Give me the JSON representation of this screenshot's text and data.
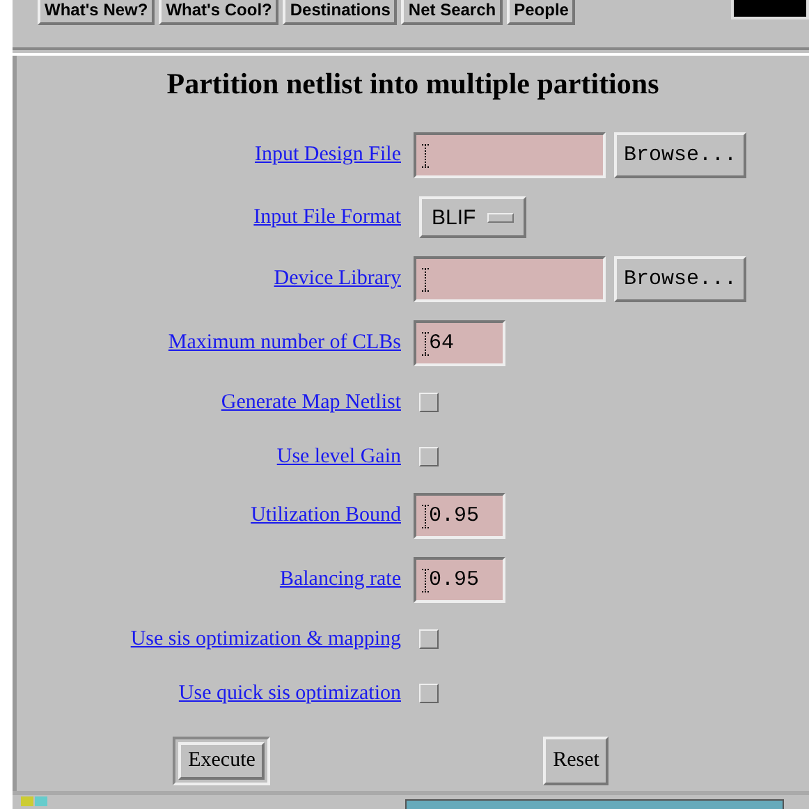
{
  "toolbar": [
    "What's New?",
    "What's Cool?",
    "Destinations",
    "Net Search",
    "People"
  ],
  "title": "Partition netlist into multiple partitions",
  "rows": [
    {
      "kind": "file",
      "label": "Input Design File",
      "value": "",
      "button": "Browse..."
    },
    {
      "kind": "select",
      "label": "Input File Format",
      "value": "BLIF"
    },
    {
      "kind": "file",
      "label": "Device Library",
      "value": "",
      "button": "Browse..."
    },
    {
      "kind": "text",
      "label": "Maximum number of CLBs",
      "value": "64"
    },
    {
      "kind": "check",
      "label": "Generate Map Netlist",
      "checked": false
    },
    {
      "kind": "check",
      "label": "Use level Gain",
      "checked": false
    },
    {
      "kind": "text",
      "label": "Utilization Bound",
      "value": "0.95"
    },
    {
      "kind": "text",
      "label": "Balancing rate",
      "value": "0.95"
    },
    {
      "kind": "check",
      "label": "Use sis optimization & mapping",
      "checked": false
    },
    {
      "kind": "check",
      "label": "Use quick sis optimization",
      "checked": false
    }
  ],
  "actions": [
    {
      "label": "Execute",
      "default": true
    },
    {
      "label": "Reset",
      "default": false
    }
  ]
}
